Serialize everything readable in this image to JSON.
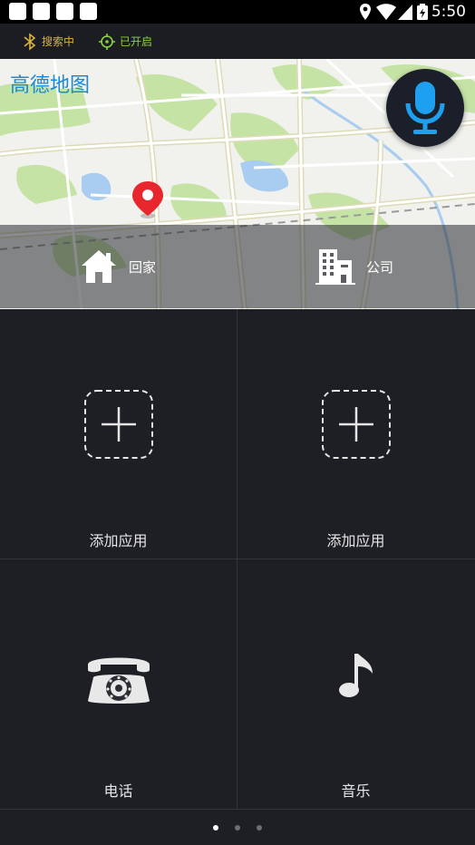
{
  "status_bar": {
    "time": "5:50",
    "icons": [
      "notification-icon",
      "notification-icon",
      "notification-icon",
      "notification-icon",
      "location-icon",
      "wifi-icon",
      "signal-icon",
      "battery-icon"
    ]
  },
  "top_strip": {
    "bluetooth_label": "搜索中",
    "location_label": "已开启",
    "bluetooth_color": "#d8b43a",
    "location_color": "#8bd13c"
  },
  "map": {
    "app_title": "高德地图",
    "title_color": "#1a89d6",
    "shortcuts": [
      {
        "label": "回家",
        "icon": "home-icon"
      },
      {
        "label": "公司",
        "icon": "building-icon"
      }
    ],
    "mic_icon": "microphone-icon",
    "mic_color": "#1ea0f0",
    "pin_icon": "map-pin-icon",
    "pin_color": "#e8262e"
  },
  "apps": [
    {
      "label": "添加应用",
      "icon": "add-app-icon"
    },
    {
      "label": "添加应用",
      "icon": "add-app-icon"
    },
    {
      "label": "电话",
      "icon": "phone-icon"
    },
    {
      "label": "音乐",
      "icon": "music-note-icon"
    }
  ],
  "pager": {
    "pages": 3,
    "active": 1
  }
}
